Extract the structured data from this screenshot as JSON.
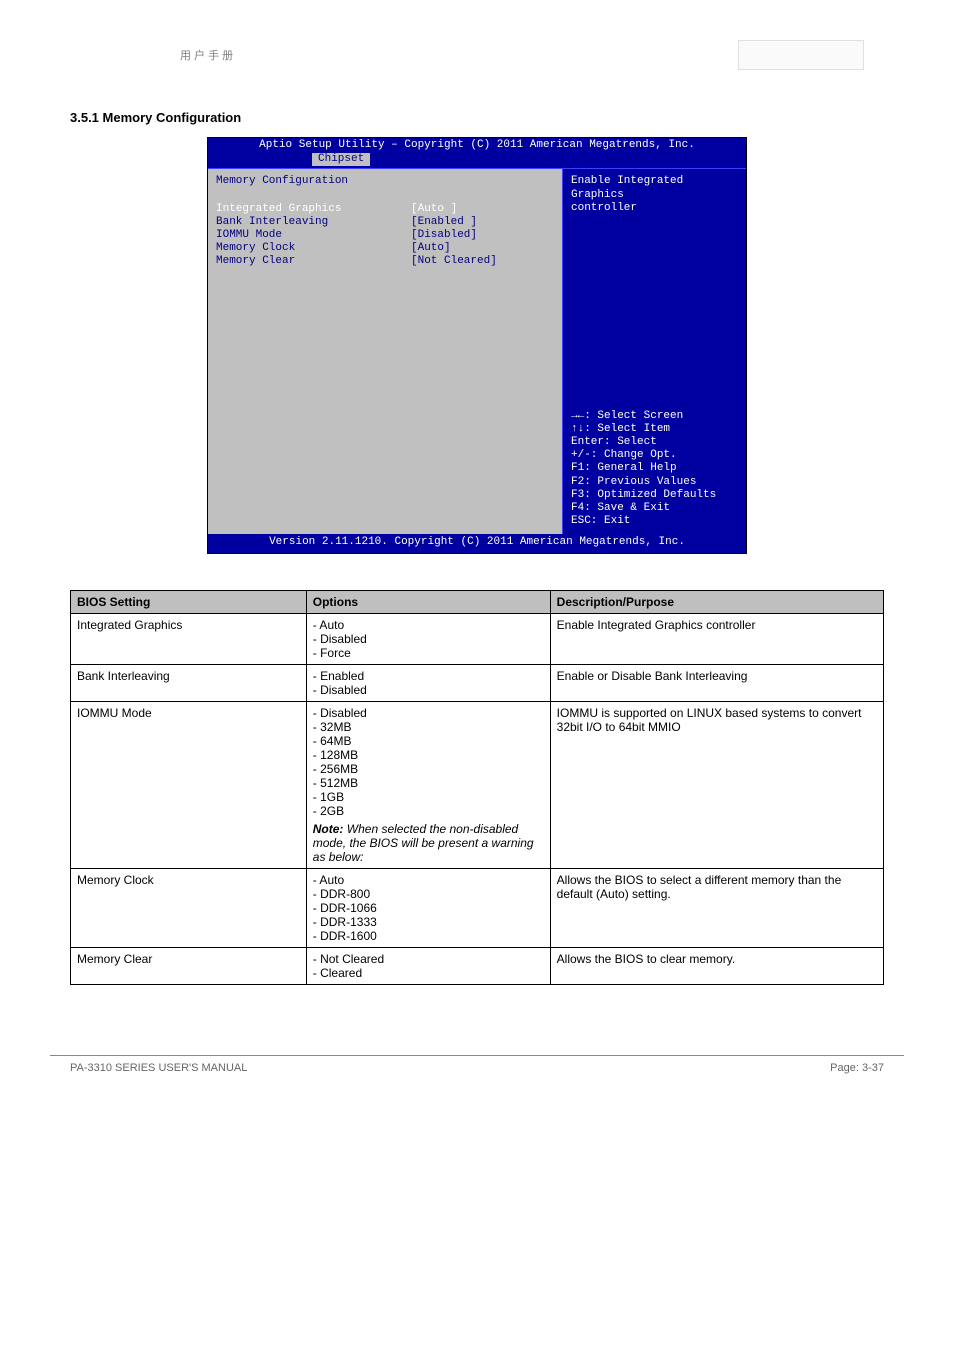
{
  "page_header": {
    "text": "用 户 手 册"
  },
  "section_heading": "3.5.1 Memory Configuration",
  "bios": {
    "title": "Aptio Setup Utility – Copyright (C) 2011 American Megatrends, Inc.",
    "tabs": {
      "chipset": "Chipset"
    },
    "left_header": "Memory Configuration",
    "settings": [
      {
        "label": "Integrated Graphics",
        "value": "[Auto ]",
        "selected": true
      },
      {
        "label": "Bank Interleaving",
        "value": "[Enabled ]"
      },
      {
        "label": "IOMMU Mode",
        "value": "[Disabled]"
      },
      {
        "label": "Memory Clock",
        "value": "[Auto]"
      },
      {
        "label": "Memory Clear",
        "value": "[Not Cleared]"
      }
    ],
    "help_top": "Enable Integrated Graphics\ncontroller",
    "help_lines": [
      "→←: Select Screen",
      "↑↓: Select Item",
      "Enter: Select",
      "+/-: Change Opt.",
      "F1: General Help",
      "F2: Previous Values",
      "F3: Optimized Defaults",
      "F4: Save & Exit",
      "ESC: Exit"
    ],
    "footer": "Version 2.11.1210. Copyright (C) 2011 American Megatrends, Inc."
  },
  "table": {
    "headers": [
      "BIOS Setting",
      "Options",
      "Description/Purpose"
    ],
    "rows": [
      {
        "setting": "Integrated Graphics",
        "options": [
          "Auto",
          "Disabled",
          "Force"
        ],
        "note": "",
        "description": "Enable Integrated Graphics controller"
      },
      {
        "setting": "Bank Interleaving",
        "options": [
          "Enabled",
          "Disabled"
        ],
        "note": "",
        "description": "Enable or Disable Bank Interleaving"
      },
      {
        "setting": "IOMMU Mode",
        "options": [
          "Disabled",
          "32MB",
          "64MB",
          "128MB",
          "256MB",
          "512MB",
          "1GB",
          "2GB"
        ],
        "note": "Note: When selected the non-disabled mode, the BIOS will be present a warning as below:",
        "description": "IOMMU is supported on LINUX based systems to convert 32bit I/O to 64bit MMIO"
      },
      {
        "setting": "Memory Clock",
        "options": [
          "Auto",
          "DDR-800",
          "DDR-1066",
          "DDR-1333",
          "DDR-1600"
        ],
        "note": "",
        "description": "Allows the BIOS to select a different memory than the default (Auto) setting."
      },
      {
        "setting": "Memory Clear",
        "options": [
          "Not Cleared",
          "Cleared"
        ],
        "note": "",
        "description": "Allows the BIOS to clear memory."
      }
    ]
  },
  "footer": {
    "left": "PA-3310 SERIES USER'S MANUAL",
    "right": "Page: 3-37"
  }
}
